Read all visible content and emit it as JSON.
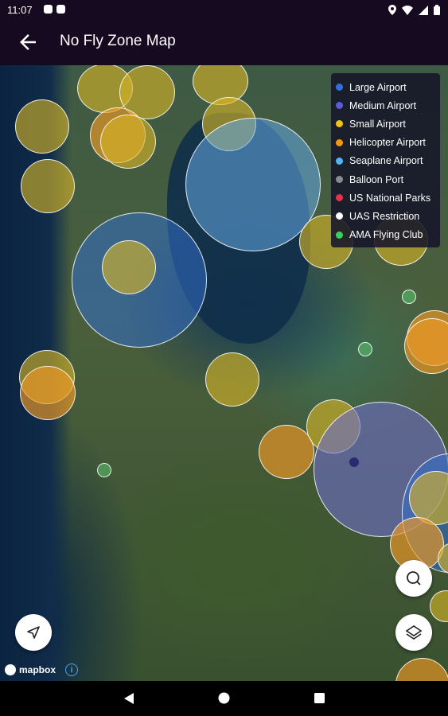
{
  "status_bar": {
    "time": "11:07",
    "left_icons": [
      "notification-icon",
      "sim-icon"
    ],
    "right_icons": [
      "location-icon",
      "wifi-icon",
      "signal-icon",
      "battery-icon"
    ]
  },
  "app_bar": {
    "back_icon": "arrow-back-icon",
    "title": "No Fly Zone Map"
  },
  "legend": {
    "items": [
      {
        "label": "Large Airport",
        "color": "#2f6fe0"
      },
      {
        "label": "Medium Airport",
        "color": "#5b5bd6"
      },
      {
        "label": "Small Airport",
        "color": "#f2c416"
      },
      {
        "label": "Helicopter Airport",
        "color": "#f2970f"
      },
      {
        "label": "Seaplane Airport",
        "color": "#4fb6ef"
      },
      {
        "label": "Balloon Port",
        "color": "#8a8a94"
      },
      {
        "label": "US National Parks",
        "color": "#e8304d"
      },
      {
        "label": "UAS Restriction",
        "color": "#ffffff"
      },
      {
        "label": "AMA Flying Club",
        "color": "#3ccf5e"
      }
    ]
  },
  "controls": {
    "search_icon": "search-icon",
    "layers_icon": "layers-icon",
    "locate_icon": "navigation-arrow-icon"
  },
  "attribution": {
    "logo_text": "mapbox",
    "info_icon": "info-icon",
    "info_symbol": "i"
  },
  "nav_bar": {
    "icons": [
      "back-triangle-icon",
      "home-circle-icon",
      "recents-square-icon"
    ]
  }
}
